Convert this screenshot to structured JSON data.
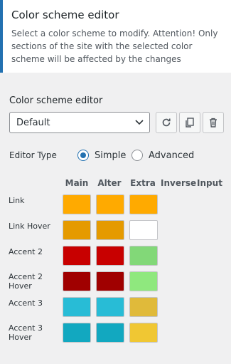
{
  "header": {
    "title": "Color scheme editor",
    "description": "Select a color scheme to modify. Attention! Only sections of the site with the selected color scheme will be affected by the changes"
  },
  "editor": {
    "label": "Color scheme editor",
    "selected_scheme": "Default",
    "buttons": [
      {
        "name": "reset",
        "icon": "refresh-icon"
      },
      {
        "name": "copy",
        "icon": "copy-icon"
      },
      {
        "name": "delete",
        "icon": "trash-icon"
      }
    ]
  },
  "editor_type": {
    "label": "Editor Type",
    "options": [
      "Simple",
      "Advanced"
    ],
    "selected": "Simple"
  },
  "columns": [
    "Main",
    "Alter",
    "Extra",
    "Inverse",
    "Input"
  ],
  "rows": [
    {
      "label": "Link",
      "colors": [
        "#ffaa00",
        "#ffaa00",
        "#ffaa00"
      ]
    },
    {
      "label": "Link Hover",
      "colors": [
        "#e59a00",
        "#e59a00",
        "#ffffff"
      ]
    },
    {
      "label": "Accent 2",
      "colors": [
        "#c80000",
        "#c80000",
        "#82d878"
      ]
    },
    {
      "label": "Accent 2 Hover",
      "colors": [
        "#a00000",
        "#a00000",
        "#8fe87e"
      ]
    },
    {
      "label": "Accent 3",
      "colors": [
        "#28bcd6",
        "#28bcd6",
        "#e0ba3a"
      ]
    },
    {
      "label": "Accent 3 Hover",
      "colors": [
        "#12a8c0",
        "#12a8c0",
        "#f0c733"
      ]
    }
  ],
  "accent_color": "#2271b1"
}
